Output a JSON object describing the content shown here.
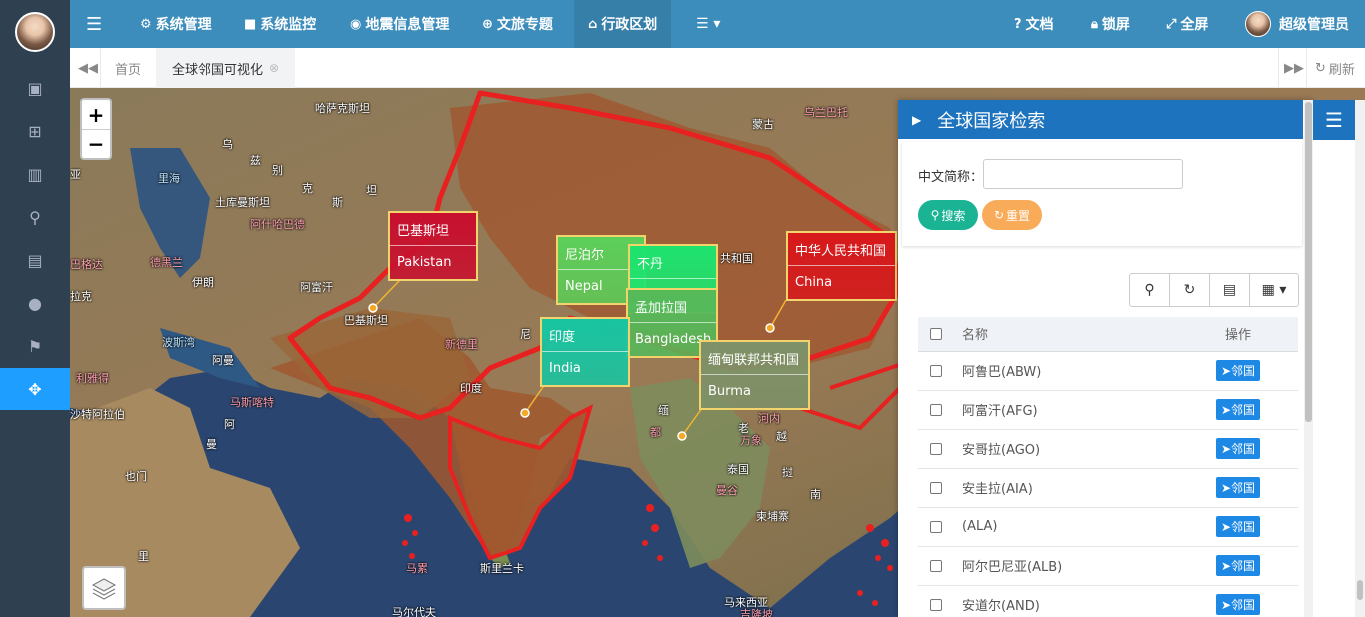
{
  "nav": {
    "items": [
      {
        "label": "系统管理",
        "icon": "gear-icon"
      },
      {
        "label": "系统监控",
        "icon": "video-icon"
      },
      {
        "label": "地震信息管理",
        "icon": "map-pin-icon"
      },
      {
        "label": "文旅专题",
        "icon": "globe-icon"
      },
      {
        "label": "行政区划",
        "icon": "bank-icon"
      }
    ],
    "right": {
      "docs": "文档",
      "lock": "锁屏",
      "fullscreen": "全屏",
      "user": "超级管理员"
    }
  },
  "tabs": {
    "home": "首页",
    "active": "全球邻国可视化",
    "refresh": "刷新"
  },
  "map_labels": [
    {
      "text": "哈萨克斯坦",
      "cls": ""
    },
    {
      "text": "乌",
      "cls": ""
    },
    {
      "text": "兹",
      "cls": ""
    },
    {
      "text": "别",
      "cls": ""
    },
    {
      "text": "克",
      "cls": ""
    },
    {
      "text": "斯",
      "cls": ""
    },
    {
      "text": "坦",
      "cls": ""
    },
    {
      "text": "土库曼斯坦",
      "cls": ""
    },
    {
      "text": "阿什哈巴德",
      "cls": "pink"
    },
    {
      "text": "里海",
      "cls": "water"
    },
    {
      "text": "巴格达",
      "cls": "pink"
    },
    {
      "text": "德黑兰",
      "cls": "pink"
    },
    {
      "text": "伊朗",
      "cls": ""
    },
    {
      "text": "阿富汗",
      "cls": ""
    },
    {
      "text": "拉克",
      "cls": ""
    },
    {
      "text": "亚",
      "cls": ""
    },
    {
      "text": "波斯湾",
      "cls": "water"
    },
    {
      "text": "巴基斯坦",
      "cls": ""
    },
    {
      "text": "阿曼",
      "cls": ""
    },
    {
      "text": "利雅得",
      "cls": "pink"
    },
    {
      "text": "马斯喀特",
      "cls": "pink"
    },
    {
      "text": "沙特阿拉伯",
      "cls": ""
    },
    {
      "text": "阿",
      "cls": ""
    },
    {
      "text": "曼",
      "cls": ""
    },
    {
      "text": "也门",
      "cls": ""
    },
    {
      "text": "里",
      "cls": ""
    },
    {
      "text": "新德里",
      "cls": "pink"
    },
    {
      "text": "印度",
      "cls": ""
    },
    {
      "text": "尼",
      "cls": ""
    },
    {
      "text": "蒙古",
      "cls": ""
    },
    {
      "text": "乌兰巴托",
      "cls": "pink"
    },
    {
      "text": "共和国",
      "cls": ""
    },
    {
      "text": "缅",
      "cls": ""
    },
    {
      "text": "老",
      "cls": ""
    },
    {
      "text": "河内",
      "cls": "pink"
    },
    {
      "text": "万象",
      "cls": "pink"
    },
    {
      "text": "越",
      "cls": ""
    },
    {
      "text": "泰国",
      "cls": ""
    },
    {
      "text": "挝",
      "cls": ""
    },
    {
      "text": "曼谷",
      "cls": "pink"
    },
    {
      "text": "南",
      "cls": ""
    },
    {
      "text": "柬埔寨",
      "cls": ""
    },
    {
      "text": "马累",
      "cls": "pink"
    },
    {
      "text": "斯里兰卡",
      "cls": ""
    },
    {
      "text": "马尔代夫",
      "cls": ""
    },
    {
      "text": "马来西亚",
      "cls": ""
    },
    {
      "text": "吉隆坡",
      "cls": "pink"
    },
    {
      "text": "都",
      "cls": "pink"
    }
  ],
  "callouts": [
    {
      "zh": "巴基斯坦",
      "en": "Pakistan",
      "color": "#c8102e"
    },
    {
      "zh": "尼泊尔",
      "en": "Nepal",
      "color": "#5ccf5a"
    },
    {
      "zh": "不丹",
      "en": "",
      "color": "#1ee36e"
    },
    {
      "zh": "孟加拉国",
      "en": "Bangladesh",
      "color": "#56b95a"
    },
    {
      "zh": "印度",
      "en": "India",
      "color": "#18c5a2"
    },
    {
      "zh": "缅甸联邦共和国",
      "en": "Burma",
      "color": "#7e9168"
    },
    {
      "zh": "中华人民共和国",
      "en": "China",
      "color": "#d7191c"
    }
  ],
  "panel": {
    "title": "全球国家检索",
    "search_label": "中文简称：",
    "search_value": "",
    "search_btn": "搜索",
    "reset_btn": "重置",
    "col_name": "名称",
    "col_action": "操作",
    "action_label": "邻国",
    "rows": [
      "阿鲁巴(ABW)",
      "阿富汗(AFG)",
      "安哥拉(AGO)",
      "安圭拉(AIA)",
      "(ALA)",
      "阿尔巴尼亚(ALB)",
      "安道尔(AND)"
    ]
  },
  "colors": {
    "topbar": "#3c8dbc",
    "sidebar": "#2f4050",
    "accent": "#1e9fff",
    "search": "#1ab394",
    "reset": "#f8ac59"
  }
}
